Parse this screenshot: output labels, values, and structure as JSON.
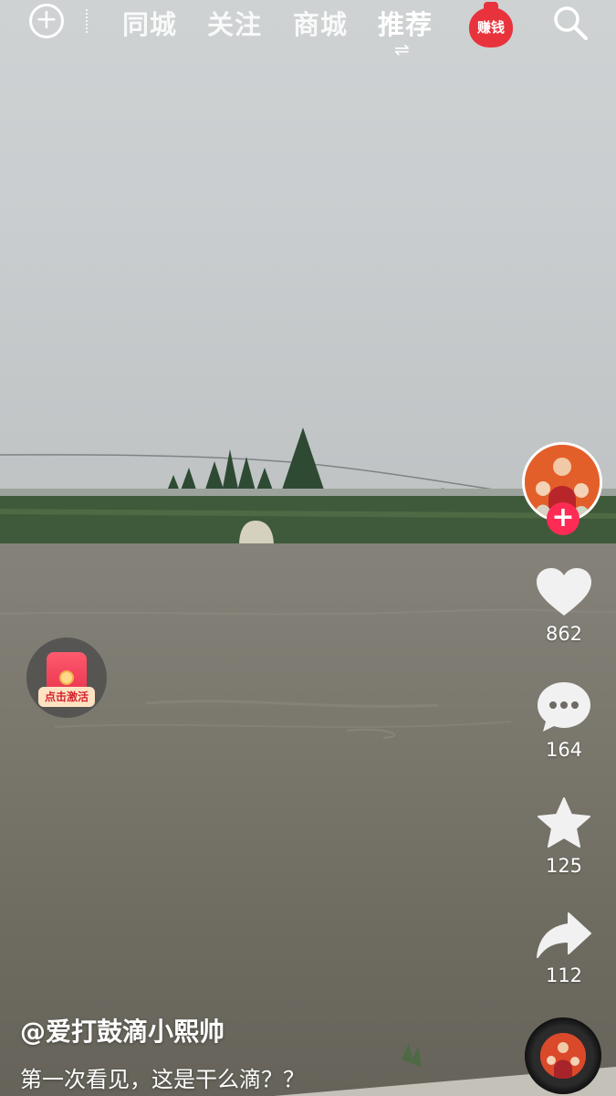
{
  "nav": {
    "add_icon": "plus-circle-icon",
    "tabs": [
      {
        "label": "同城"
      },
      {
        "label": "关注"
      },
      {
        "label": "商城"
      },
      {
        "label": "推荐",
        "active": true
      }
    ],
    "switch_icon": "⇌",
    "earn_label": "赚钱",
    "search_icon": "search-icon"
  },
  "creator": {
    "follow_symbol": "+"
  },
  "actions": {
    "likes": "862",
    "comments": "164",
    "favorites": "125",
    "shares": "112"
  },
  "promo": {
    "cta": "点击激活"
  },
  "caption": {
    "author": "@爱打鼓滴小熙帅",
    "text": "第一次看见，这是干么滴？？"
  },
  "colors": {
    "accent": "#fe2c55",
    "earn": "#e8333c"
  }
}
